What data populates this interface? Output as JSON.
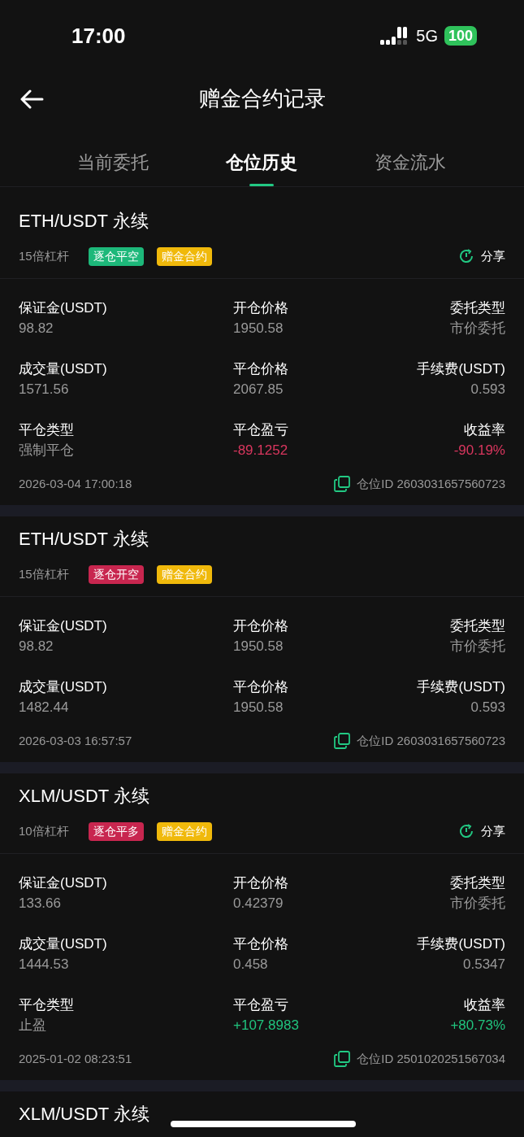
{
  "status_bar": {
    "time": "17:00",
    "network": "5G",
    "battery": "100"
  },
  "header": {
    "title": "赠金合约记录"
  },
  "tabs": [
    {
      "label": "当前委托",
      "selected": false
    },
    {
      "label": "仓位历史",
      "selected": true
    },
    {
      "label": "资金流水",
      "selected": false
    }
  ],
  "positions": [
    {
      "title": "ETH/USDT 永续",
      "leverage": "15倍杠杆",
      "tags": [
        {
          "label": "逐仓平空",
          "color": "#1db87a"
        },
        {
          "label": "赠金合约",
          "color": "#f0b90b"
        }
      ],
      "share": "分享",
      "fields": [
        {
          "label": "保证金(USDT)",
          "value": "98.82",
          "color": "#9a9a9a"
        },
        {
          "label": "开仓价格",
          "value": "1950.58",
          "color": "#9a9a9a"
        },
        {
          "label": "委托类型",
          "value": "市价委托",
          "color": "#9a9a9a"
        },
        {
          "label": "成交量(USDT)",
          "value": "1571.56",
          "color": "#9a9a9a"
        },
        {
          "label": "平仓价格",
          "value": "2067.85",
          "color": "#9a9a9a"
        },
        {
          "label": "手续费(USDT)",
          "value": "0.593",
          "color": "#9a9a9a"
        },
        {
          "label": "平仓类型",
          "value": "强制平仓",
          "color": "#9a9a9a"
        },
        {
          "label": "平仓盈亏",
          "value": "-89.1252",
          "color": "#d9365e"
        },
        {
          "label": "收益率",
          "value": "-90.19%",
          "color": "#d9365e"
        }
      ],
      "time": "2026-03-04 17:00:18",
      "position_id": "仓位ID 2603031657560723"
    },
    {
      "title": "ETH/USDT 永续",
      "leverage": "15倍杠杆",
      "tags": [
        {
          "label": "逐仓开空",
          "color": "#c8264f"
        },
        {
          "label": "赠金合约",
          "color": "#f0b90b"
        }
      ],
      "fields": [
        {
          "label": "保证金(USDT)",
          "value": "98.82",
          "color": "#9a9a9a"
        },
        {
          "label": "开仓价格",
          "value": "1950.58",
          "color": "#9a9a9a"
        },
        {
          "label": "委托类型",
          "value": "市价委托",
          "color": "#9a9a9a"
        },
        {
          "label": "成交量(USDT)",
          "value": "1482.44",
          "color": "#9a9a9a"
        },
        {
          "label": "平仓价格",
          "value": "1950.58",
          "color": "#9a9a9a"
        },
        {
          "label": "手续费(USDT)",
          "value": "0.593",
          "color": "#9a9a9a"
        }
      ],
      "time": "2026-03-03 16:57:57",
      "position_id": "仓位ID 2603031657560723"
    },
    {
      "title": "XLM/USDT 永续",
      "leverage": "10倍杠杆",
      "tags": [
        {
          "label": "逐仓平多",
          "color": "#c8264f"
        },
        {
          "label": "赠金合约",
          "color": "#f0b90b"
        }
      ],
      "share": "分享",
      "fields": [
        {
          "label": "保证金(USDT)",
          "value": "133.66",
          "color": "#9a9a9a"
        },
        {
          "label": "开仓价格",
          "value": "0.42379",
          "color": "#9a9a9a"
        },
        {
          "label": "委托类型",
          "value": "市价委托",
          "color": "#9a9a9a"
        },
        {
          "label": "成交量(USDT)",
          "value": "1444.53",
          "color": "#9a9a9a"
        },
        {
          "label": "平仓价格",
          "value": "0.458",
          "color": "#9a9a9a"
        },
        {
          "label": "手续费(USDT)",
          "value": "0.5347",
          "color": "#9a9a9a"
        },
        {
          "label": "平仓类型",
          "value": "止盈",
          "color": "#9a9a9a"
        },
        {
          "label": "平仓盈亏",
          "value": "+107.8983",
          "color": "#20c47e"
        },
        {
          "label": "收益率",
          "value": "+80.73%",
          "color": "#20c47e"
        }
      ],
      "time": "2025-01-02 08:23:51",
      "position_id": "仓位ID 2501020251567034"
    },
    {
      "title": "XLM/USDT 永续"
    }
  ]
}
